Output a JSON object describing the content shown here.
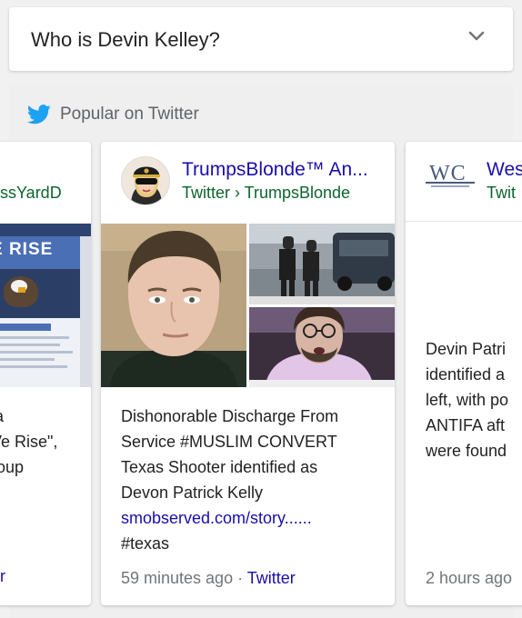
{
  "question": {
    "text": "Who is Devin Kelley?"
  },
  "twitter_section": {
    "header": "Popular on Twitter",
    "left_card": {
      "handle": "essYardD",
      "media_text": "E RISE",
      "body_lines": [
        "a",
        "Ve Rise\",",
        "roup"
      ],
      "meta": "er"
    },
    "main_card": {
      "author_name": "TrumpsBlonde™ An...",
      "handle": "Twitter › TrumpsBlonde",
      "body_lines": [
        "Dishonorable Discharge From",
        "Service #MUSLIM CONVERT",
        "Texas Shooter identified as",
        "Devon Patrick Kelly"
      ],
      "link": "smobserved.com/story......",
      "hashtag": "#texas",
      "time": "59 minutes ago",
      "separator": " · ",
      "source": "Twitter"
    },
    "right_card": {
      "logo_text": "WC",
      "author_name": "Wes",
      "handle": "Twit",
      "body_lines": [
        "Devin Patri",
        "identified a",
        "left, with po",
        "ANTIFA aft",
        "were found"
      ],
      "time": "2 hours ago"
    }
  },
  "colors": {
    "link_blue": "#1a0dab",
    "url_green": "#0d652d",
    "meta_gray": "#70757a",
    "twitter_blue": "#1da1f2"
  }
}
